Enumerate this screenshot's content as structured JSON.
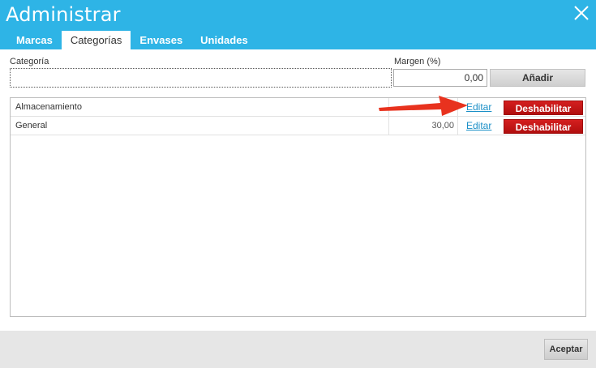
{
  "window": {
    "title": "Administrar"
  },
  "tabs": [
    {
      "label": "Marcas",
      "active": false
    },
    {
      "label": "Categorías",
      "active": true
    },
    {
      "label": "Envases",
      "active": false
    },
    {
      "label": "Unidades",
      "active": false
    }
  ],
  "form": {
    "category_label": "Categoría",
    "category_value": "",
    "margin_label": "Margen (%)",
    "margin_value": "0,00",
    "add_label": "Añadir"
  },
  "rows": [
    {
      "name": "Almacenamiento",
      "margin": "",
      "edit_label": "Editar",
      "disable_label": "Deshabilitar"
    },
    {
      "name": "General",
      "margin": "30,00",
      "edit_label": "Editar",
      "disable_label": "Deshabilitar"
    }
  ],
  "footer": {
    "accept_label": "Aceptar"
  },
  "colors": {
    "header": "#2eb4e6",
    "disable_button": "#c41717",
    "link": "#1a8fc7",
    "arrow": "#e8321e"
  },
  "icons": {
    "close": "close-icon",
    "annotation": "red-arrow-icon"
  }
}
